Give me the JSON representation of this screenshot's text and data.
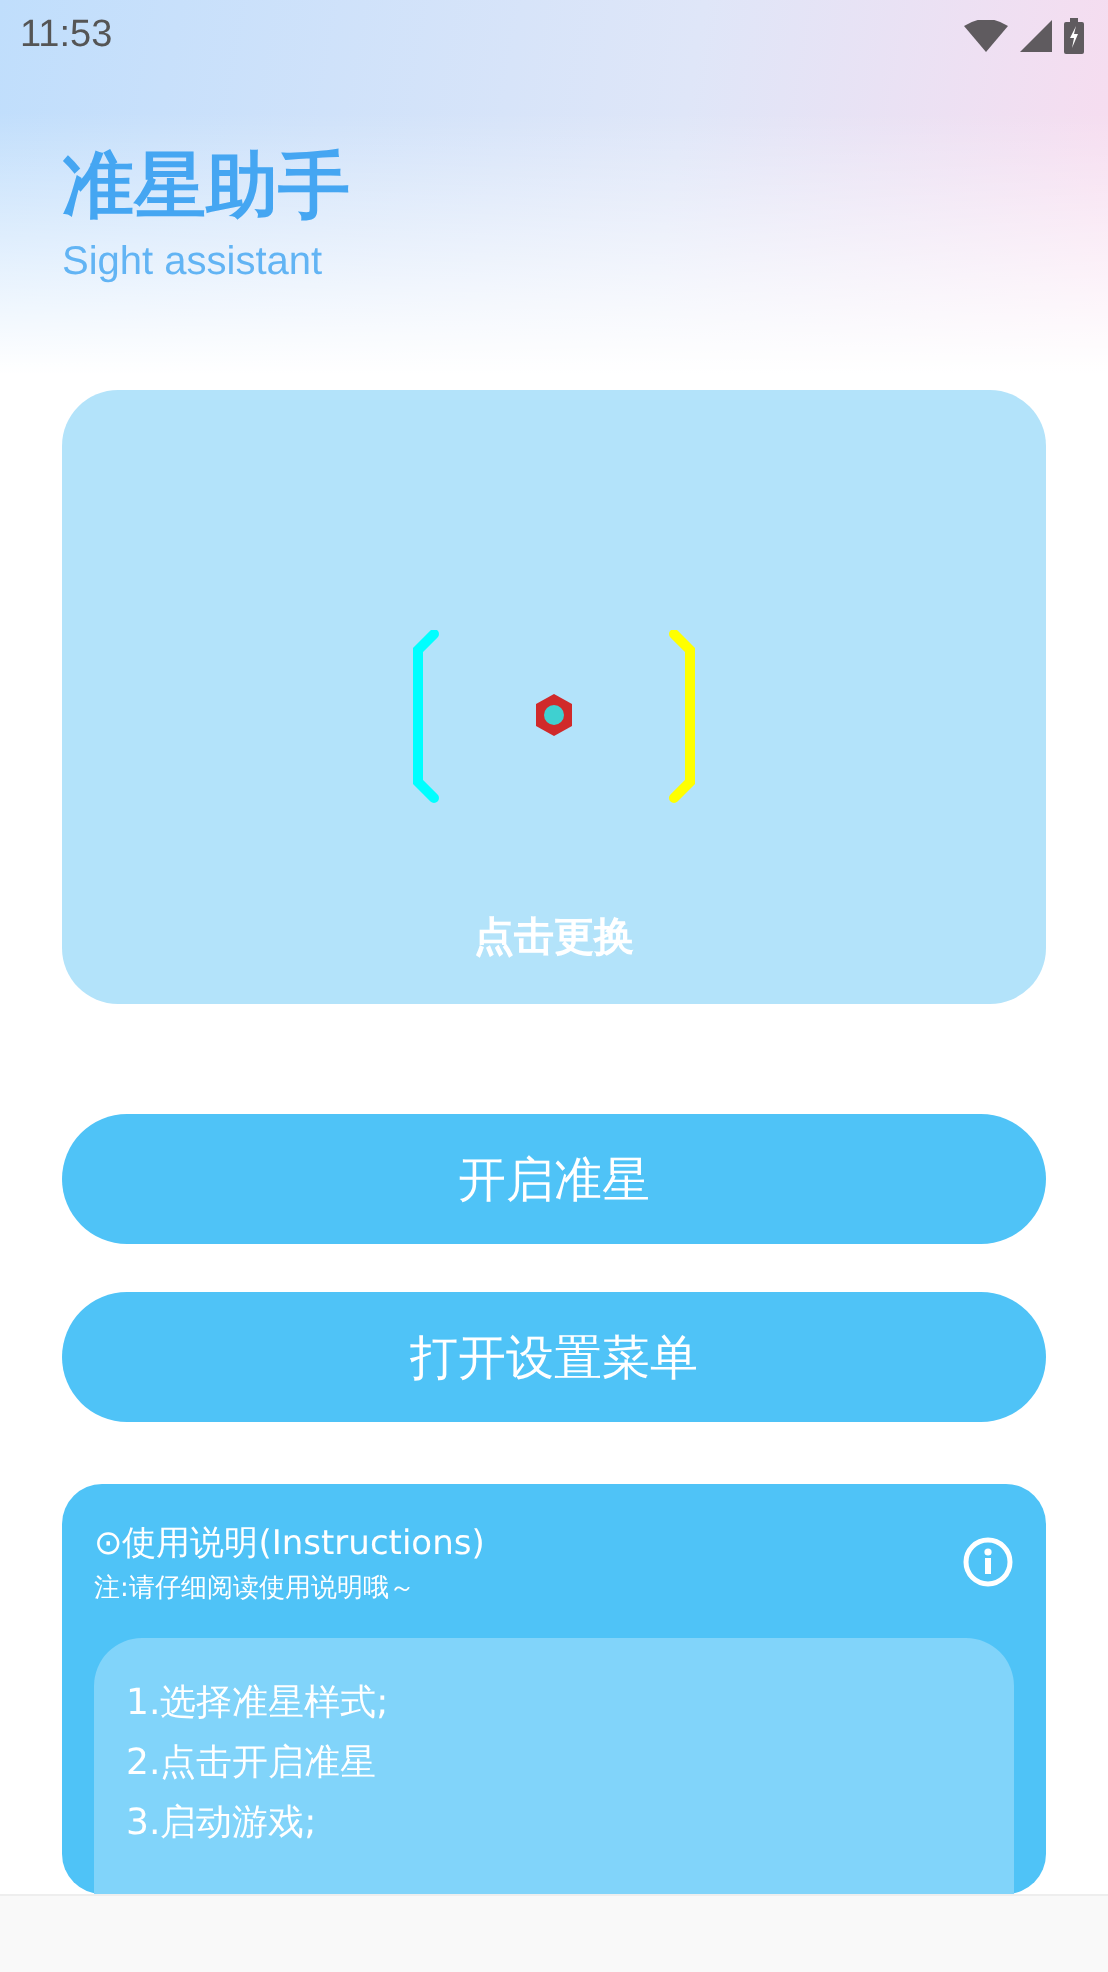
{
  "status_bar": {
    "time": "11:53"
  },
  "header": {
    "title": "准星助手",
    "subtitle": "Sight assistant"
  },
  "preview": {
    "caption": "点击更换"
  },
  "buttons": [
    {
      "label": "开启准星"
    },
    {
      "label": "打开设置菜单"
    }
  ],
  "instructions": {
    "title": "⊙使用说明(Instructions)",
    "note": "注:请仔细阅读使用说明哦～",
    "steps": [
      "1.选择准星样式;",
      "2.点击开启准星",
      "3.启动游戏;"
    ]
  }
}
